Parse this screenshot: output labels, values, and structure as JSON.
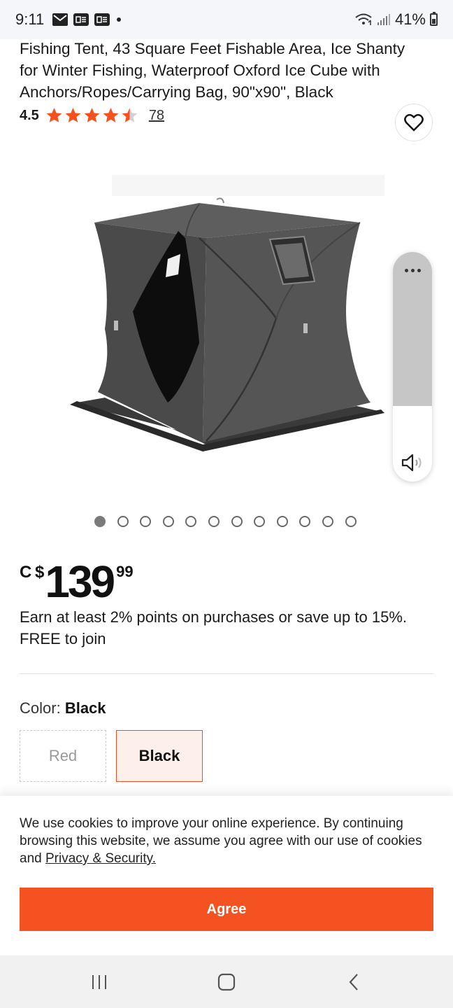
{
  "status_bar": {
    "time": "9:11",
    "battery": "41%",
    "icons": [
      "mail-icon",
      "app-badge-icon",
      "app-badge-icon",
      "dot-icon",
      "wifi-icon",
      "signal-icon",
      "battery-icon"
    ]
  },
  "product": {
    "title": "Fishing Tent, 43 Square Feet Fishable Area, Ice Shanty for Winter Fishing, Waterproof Oxford Ice Cube with Anchors/Ropes/Carrying Bag, 90\"x90\", Black",
    "rating": "4.5",
    "rating_value": 4.5,
    "rating_max": 5,
    "review_count": "78"
  },
  "gallery": {
    "image_count": 12,
    "active_index": 0,
    "image_icon": "ice-fishing-tent-image"
  },
  "price": {
    "currency": "C $",
    "dollars": "139",
    "cents": "99"
  },
  "points_text": "Earn at least 2% points on purchases or save up to 15%. FREE to join",
  "color": {
    "label": "Color:",
    "selected": "Black",
    "options": [
      {
        "label": "Red"
      },
      {
        "label": "Black"
      }
    ]
  },
  "cookie": {
    "text": "We use cookies to improve your online experience. By continuing browsing this website, we assume you agree with our use of cookies and",
    "link": "Privacy & Security.",
    "button": "Agree"
  },
  "colors": {
    "accent": "#f55222",
    "star": "#f4511e",
    "selected_bg": "#fdf0eb"
  }
}
